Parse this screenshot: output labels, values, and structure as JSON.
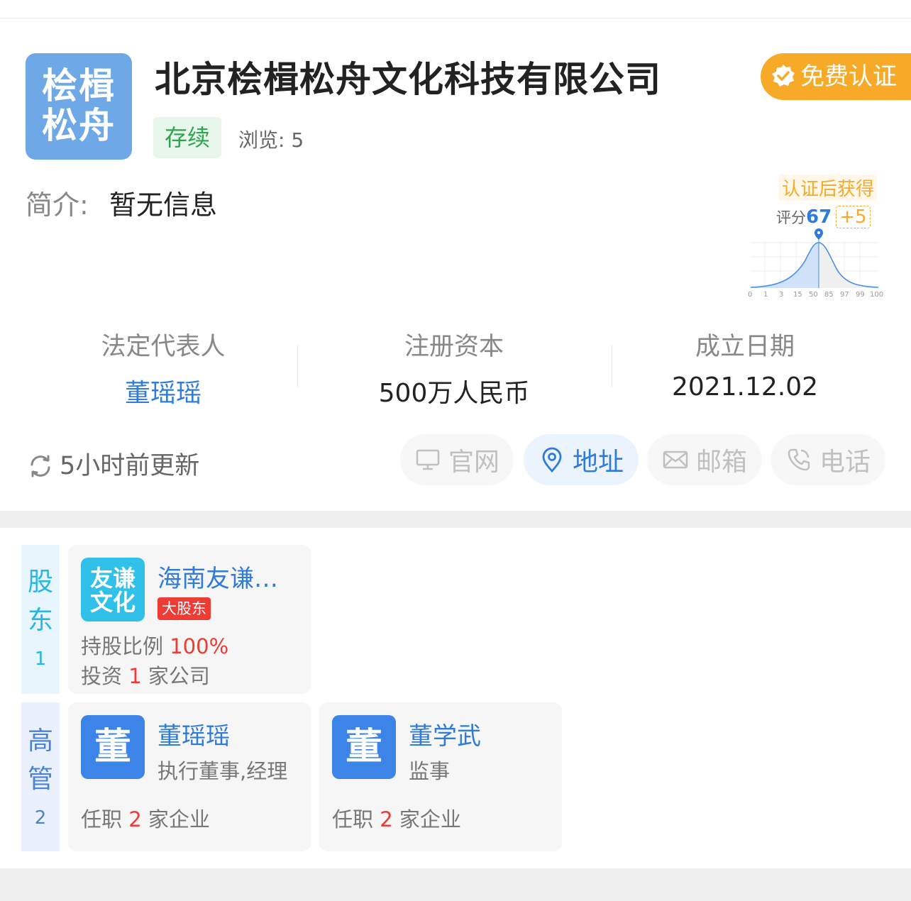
{
  "company": {
    "logo_line1": "桧楫",
    "logo_line2": "松舟",
    "name": "北京桧楫松舟文化科技有限公司",
    "status": "存续",
    "views_label": "浏览:",
    "views_value": "5",
    "cert_button": "免费认证",
    "intro_label": "简介:",
    "intro_value": "暂无信息"
  },
  "score": {
    "tag": "认证后获得",
    "label": "评分",
    "value": "67",
    "bonus": "+5",
    "axis_ticks": [
      "0",
      "1",
      "3",
      "15",
      "50",
      "85",
      "97",
      "99",
      "100"
    ]
  },
  "info": {
    "legal_rep_label": "法定代表人",
    "legal_rep_value": "董瑶瑶",
    "capital_label": "注册资本",
    "capital_value": "500万人民币",
    "founded_label": "成立日期",
    "founded_value": "2021.12.02"
  },
  "contact": {
    "refresh": "5小时前更新",
    "website": "官网",
    "address": "地址",
    "email": "邮箱",
    "phone": "电话"
  },
  "shareholders": {
    "tag_line1": "股",
    "tag_line2": "东",
    "count": "1",
    "items": [
      {
        "logo_line1": "友谦",
        "logo_line2": "文化",
        "name": "海南友谦…",
        "badge": "大股东",
        "ratio_label": "持股比例",
        "ratio_value": "100%",
        "invest_prefix": "投资",
        "invest_count": "1",
        "invest_suffix": "家公司"
      }
    ]
  },
  "management": {
    "tag_line1": "高",
    "tag_line2": "管",
    "count": "2",
    "items": [
      {
        "avatar": "董",
        "name": "董瑶瑶",
        "role": "执行董事,经理",
        "pos_prefix": "任职",
        "pos_count": "2",
        "pos_suffix": "家企业"
      },
      {
        "avatar": "董",
        "name": "董学武",
        "role": "监事",
        "pos_prefix": "任职",
        "pos_count": "2",
        "pos_suffix": "家企业"
      }
    ]
  },
  "colors": {
    "accent_blue": "#2f7bd9",
    "status_green": "#2ea650",
    "cert_orange": "#f7a928",
    "highlight_red": "#ee3b33"
  }
}
